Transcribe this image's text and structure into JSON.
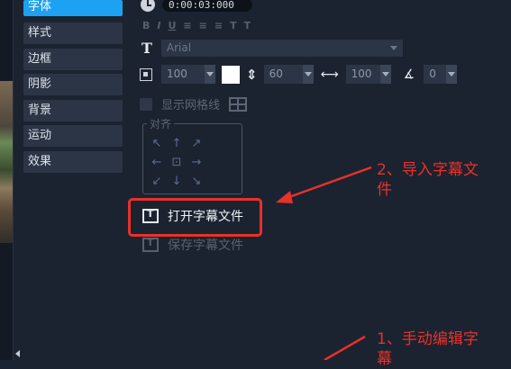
{
  "tabs": [
    {
      "label": "字体",
      "active": true
    },
    {
      "label": "样式",
      "active": false
    },
    {
      "label": "边框",
      "active": false
    },
    {
      "label": "阴影",
      "active": false
    },
    {
      "label": "背景",
      "active": false
    },
    {
      "label": "运动",
      "active": false
    },
    {
      "label": "效果",
      "active": false
    }
  ],
  "timecode": "0:00:03:000",
  "format_buttons": [
    "B",
    "I",
    "U",
    "≡",
    "≡",
    "≡",
    "T",
    "T"
  ],
  "font": {
    "name": "Arial"
  },
  "size_row": {
    "size": "100",
    "color": "#ffffff",
    "line_spacing": "60",
    "width_scale": "100",
    "angle": "0"
  },
  "grid": {
    "label": "显示网格线",
    "checked": false
  },
  "alignment": {
    "label": "对齐",
    "arrows": [
      "↖",
      "↑",
      "↗",
      "←",
      "⊡",
      "→",
      "↙",
      "↓",
      "↘"
    ]
  },
  "open_subtitle_label": "打开字幕文件",
  "save_subtitle_label": "保存字幕文件",
  "annotations": {
    "step2_line1": "2、导入字幕文",
    "step2_line2": "件",
    "step1_line1": "1、手动编辑字",
    "step1_line2": "幕"
  },
  "colors": {
    "accent": "#1da1f2",
    "annotation": "#e8312a",
    "background": "#1c2330"
  }
}
